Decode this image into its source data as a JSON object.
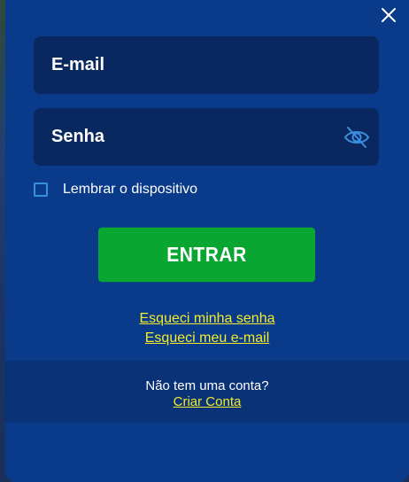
{
  "login": {
    "email_placeholder": "E-mail",
    "password_placeholder": "Senha",
    "remember_label": "Lembrar o dispositivo",
    "submit_label": "ENTRAR",
    "forgot_password": "Esqueci minha senha",
    "forgot_email": "Esqueci meu e-mail"
  },
  "footer": {
    "prompt": "Não tem uma conta?",
    "create_account": "Criar Conta"
  },
  "icons": {
    "close": "close-icon",
    "password_visibility": "eye-slash-icon"
  },
  "colors": {
    "modal_bg": "#0a3a8a",
    "field_bg": "#08285f",
    "footer_bg": "#0a3277",
    "button": "#0aa632",
    "link": "#f2ec2c",
    "accent": "#3b8fe0"
  }
}
